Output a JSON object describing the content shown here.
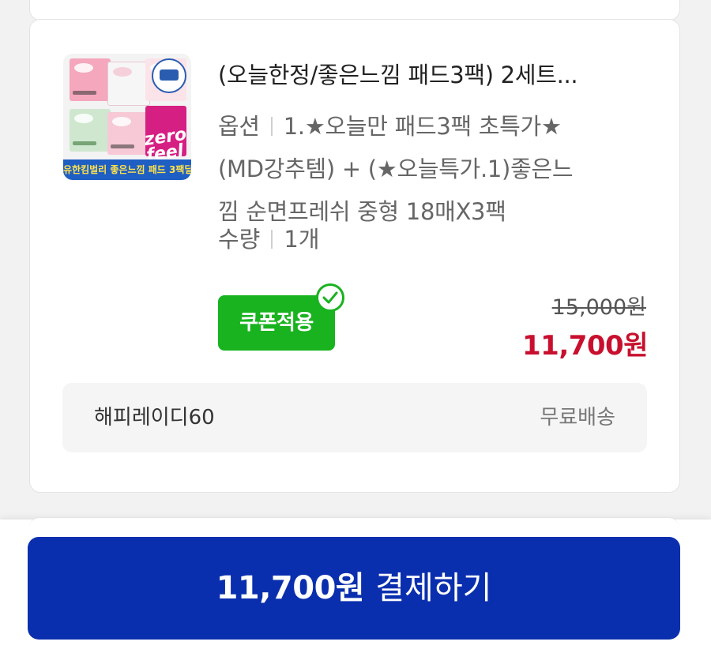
{
  "product": {
    "title": "(오늘한정/좋은느낌 패드3팩) 2세트...",
    "thumbnail_banner": "유한킴벌리 좋은느낌 패드 3팩딜",
    "thumbnail_pack_text": "zero feel",
    "option_label": "옵션",
    "option_lines": [
      "1.★오늘만 패드3팩 초특가★",
      "(MD강추템) + (★오늘특가.1)좋은느",
      "낌 순면프레쉬 중형 18매X3팩"
    ],
    "quantity_label": "수량",
    "quantity_value": "1개",
    "coupon_badge": "쿠폰적용",
    "original_price": "15,000원",
    "sale_price": "11,700원"
  },
  "shipping": {
    "seller": "해피레이디60",
    "fee": "무료배송"
  },
  "payment": {
    "amount": "11,700원",
    "label": "결제하기"
  },
  "colors": {
    "coupon_green": "#18b31f",
    "sale_red": "#c8102e",
    "pay_blue": "#0a2fae"
  }
}
